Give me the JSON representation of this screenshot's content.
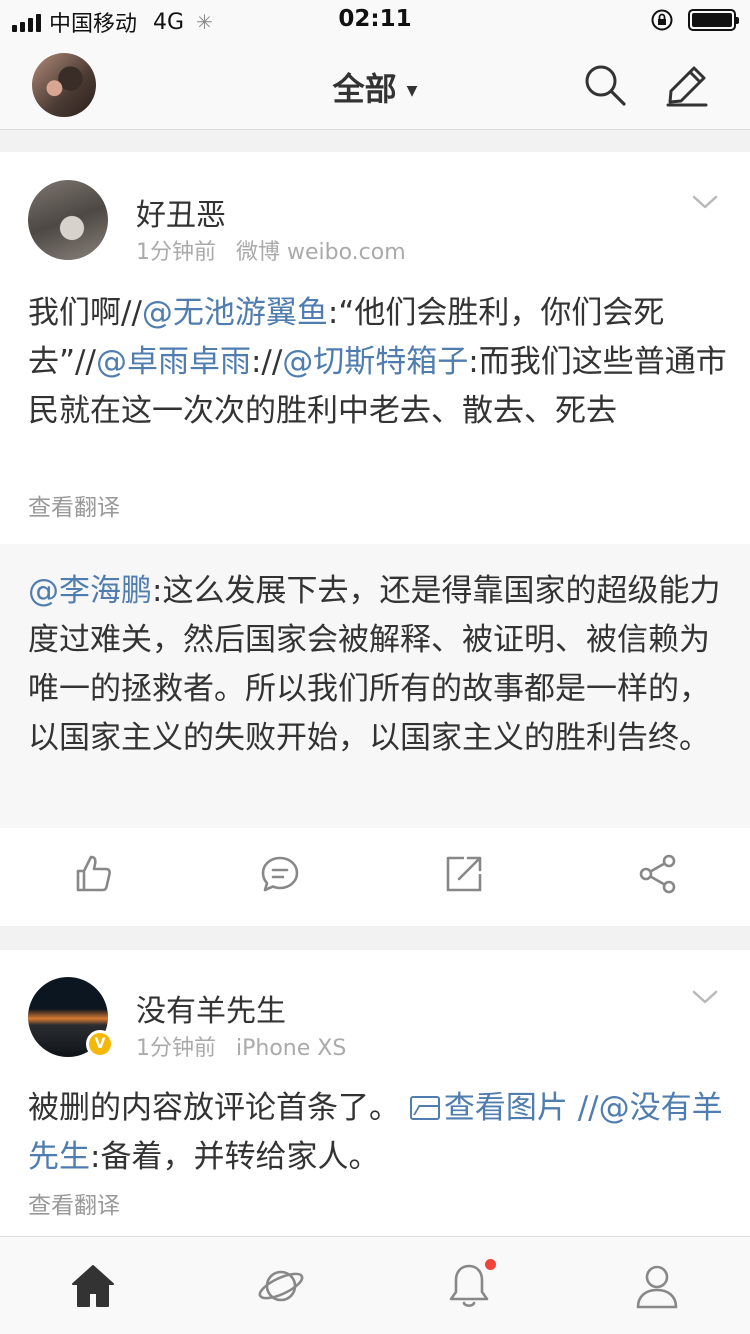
{
  "status_bar": {
    "carrier": "中国移动",
    "network": "4G",
    "time": "02:11",
    "battery_level": 1.0
  },
  "nav": {
    "title": "全部"
  },
  "posts": [
    {
      "username": "好丑恶",
      "time": "1分钟前",
      "source": "微博 weibo.com",
      "verified": false,
      "body_parts": [
        "我们啊//",
        "@无池游翼鱼",
        ":“他们会胜利，你们会死去”//",
        "@卓雨卓雨",
        "://",
        "@切斯特箱子",
        ":而我们这些普通市民就在这一次次的胜利中老去、散去、死去"
      ],
      "translate": "查看翻译",
      "repost": {
        "mention": "@李海鹏",
        "text": ":这么发展下去，还是得靠国家的超级能力度过难关，然后国家会被解释、被证明、被信赖为唯一的拯救者。所以我们所有的故事都是一样的，以国家主义的失败开始，以国家主义的胜利告终。"
      }
    },
    {
      "username": "没有羊先生",
      "time": "1分钟前",
      "source": "iPhone XS",
      "verified": true,
      "verified_badge": "V",
      "body_parts": [
        "被删的内容放评论首条了。",
        "查看图片",
        " //",
        "@没有羊先生",
        ":备着，并转给家人。"
      ],
      "translate": "查看翻译"
    }
  ],
  "colors": {
    "link": "#507daf",
    "badge": "#f5b70a",
    "notification_dot": "#f0433a"
  },
  "icons": {
    "actions": [
      "like-icon",
      "comment-icon",
      "repost-icon",
      "share-icon"
    ],
    "tabs": [
      "home-icon",
      "discover-icon",
      "message-icon",
      "profile-icon"
    ]
  }
}
